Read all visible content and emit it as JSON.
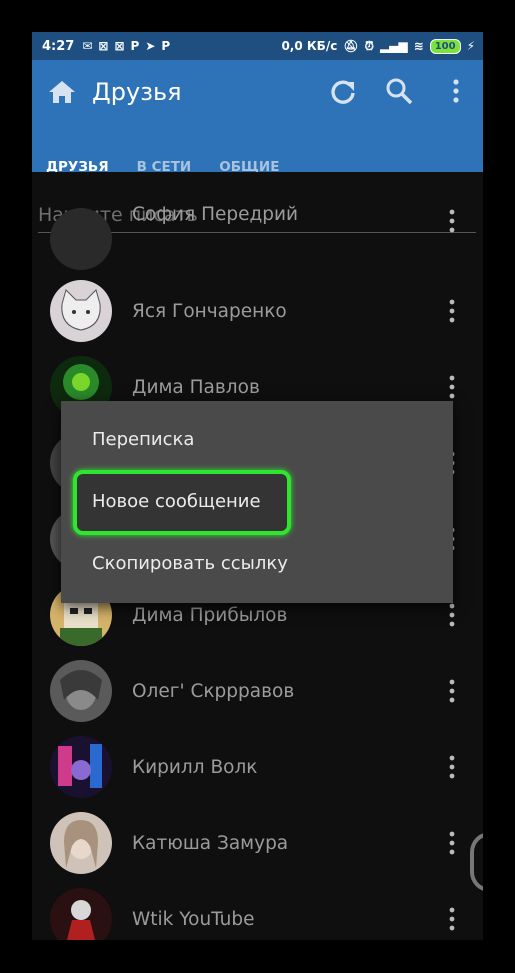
{
  "status_bar": {
    "time": "4:27",
    "speed": "0,0 КБ/с",
    "battery": "100",
    "notif_icons": [
      "mail-icon",
      "app-icon",
      "app-icon",
      "p-icon",
      "telegram-icon",
      "p-icon"
    ]
  },
  "app_bar": {
    "title": "Друзья",
    "tabs": [
      "ДРУЗЬЯ",
      "В СЕТИ",
      "ОБЩИЕ"
    ]
  },
  "search": {
    "placeholder": "Начните писать"
  },
  "friends": [
    {
      "name": "София Передрий",
      "avatar_color": "#2b2a2a"
    },
    {
      "name": "Яся Гончаренко",
      "avatar_color": "#d9d2d6"
    },
    {
      "name": "Дима Павлов",
      "avatar_color": "#1a5a1a"
    },
    {
      "name": "",
      "avatar_color": "#444"
    },
    {
      "name": "",
      "avatar_color": "#555"
    },
    {
      "name": "Дима Прибылов",
      "avatar_color": "#d6b36a"
    },
    {
      "name": "Олег' Скррравов",
      "avatar_color": "#6f6f6f"
    },
    {
      "name": "Кирилл Волк",
      "avatar_color": "#3a2a5a"
    },
    {
      "name": "Катюша Замура",
      "avatar_color": "#cfc2b8"
    },
    {
      "name": "Wtik YouTube",
      "avatar_color": "#7a1f1f"
    }
  ],
  "context_menu": {
    "items": [
      "Переписка",
      "Новое сообщение",
      "Скопировать ссылку"
    ]
  },
  "colors": {
    "status_bar": "#1e4f80",
    "app_bar": "#2e73b8",
    "tab_indicator": "#e91e63",
    "highlight": "#2ee62e"
  }
}
